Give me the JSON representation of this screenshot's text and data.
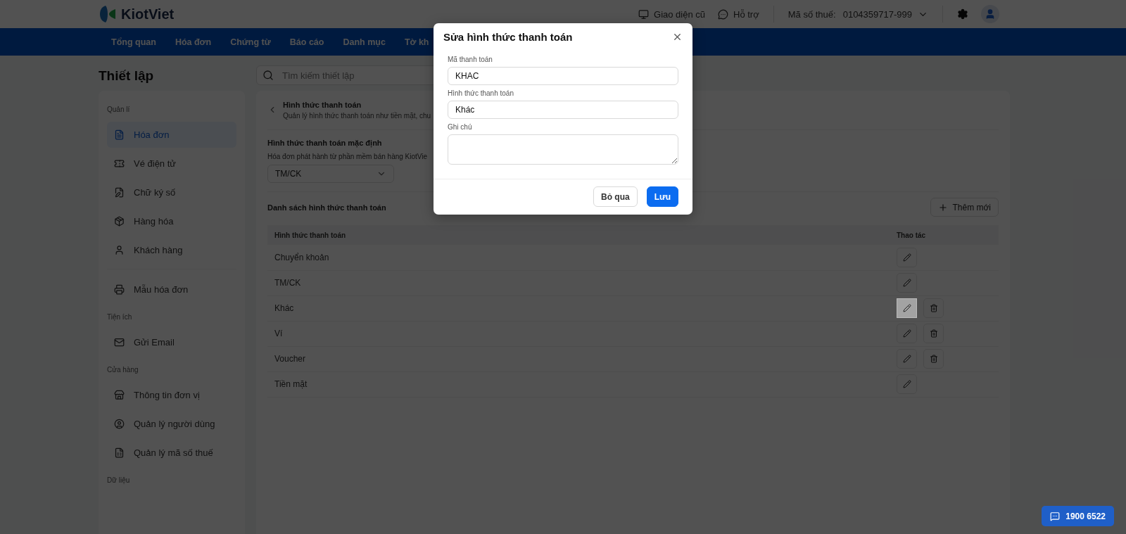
{
  "header": {
    "logo_text": "KiotViet",
    "links": [
      {
        "label": "Giao diện cũ"
      },
      {
        "label": "Hỗ trợ"
      }
    ],
    "tax": {
      "label": "Mã số thuế:",
      "value": "0104359717-999"
    }
  },
  "nav": [
    {
      "label": "Tổng quan"
    },
    {
      "label": "Hóa đơn"
    },
    {
      "label": "Chứng từ"
    },
    {
      "label": "Báo cáo"
    },
    {
      "label": "Danh mục"
    },
    {
      "label": "Tờ kh"
    }
  ],
  "page_title": "Thiết lập",
  "search": {
    "placeholder": "Tìm kiếm thiết lập"
  },
  "sidebar": {
    "sections": [
      {
        "label": "Quản lí",
        "items": [
          {
            "label": "Hóa đơn",
            "selected": true
          },
          {
            "label": "Vé điện tử",
            "selected": false
          },
          {
            "label": "Chữ ký số",
            "selected": false
          },
          {
            "label": "Hàng hóa",
            "selected": false
          },
          {
            "label": "Khách hàng",
            "selected": false
          }
        ]
      },
      {
        "items": [
          {
            "label": "Mẫu hóa đơn",
            "selected": false
          }
        ]
      },
      {
        "label": "Tiện ích",
        "items": [
          {
            "label": "Gửi Email",
            "selected": false
          }
        ]
      },
      {
        "label": "Cửa hàng",
        "items": [
          {
            "label": "Thông tin đơn vị",
            "selected": false
          },
          {
            "label": "Quản lý người dùng",
            "selected": false
          },
          {
            "label": "Quản lý mã số thuế",
            "selected": false
          }
        ]
      },
      {
        "label": "Dữ liệu"
      }
    ]
  },
  "main": {
    "title": "Hình thức thanh toán",
    "subtitle": "Quản lý hình thức thanh toán như tiền mặt, chu",
    "default_section": {
      "title": "Hình thức thanh toán mặc định",
      "description": "Hóa đơn phát hành từ phần mềm bán hàng KiotVie",
      "select_value": "TM/CK"
    },
    "list_title": "Danh sách hình thức thanh toán",
    "add_button": "Thêm mới",
    "table": {
      "columns": [
        "Hình thức thanh toán",
        "Thao tác"
      ],
      "rows": [
        {
          "name": "Chuyển khoản",
          "deletable": false,
          "hovered": false
        },
        {
          "name": "TM/CK",
          "deletable": false,
          "hovered": false
        },
        {
          "name": "Khác",
          "deletable": true,
          "hovered": true
        },
        {
          "name": "Ví",
          "deletable": true,
          "hovered": false
        },
        {
          "name": "Voucher",
          "deletable": true,
          "hovered": false
        },
        {
          "name": "Tiền mặt",
          "deletable": false,
          "hovered": false
        }
      ]
    }
  },
  "dialog": {
    "title": "Sửa hình thức thanh toán",
    "fields": [
      {
        "kind": "input",
        "label": "Mã thanh toán",
        "value": "KHAC"
      },
      {
        "kind": "input",
        "label": "Hình thức thanh toán",
        "value": "Khác"
      },
      {
        "kind": "textarea",
        "label": "Ghi chú"
      }
    ],
    "buttons": [
      {
        "label": "Bỏ qua",
        "kind": "secondary"
      },
      {
        "label": "Lưu",
        "kind": "primary"
      }
    ]
  },
  "hotline": "1900 6522"
}
